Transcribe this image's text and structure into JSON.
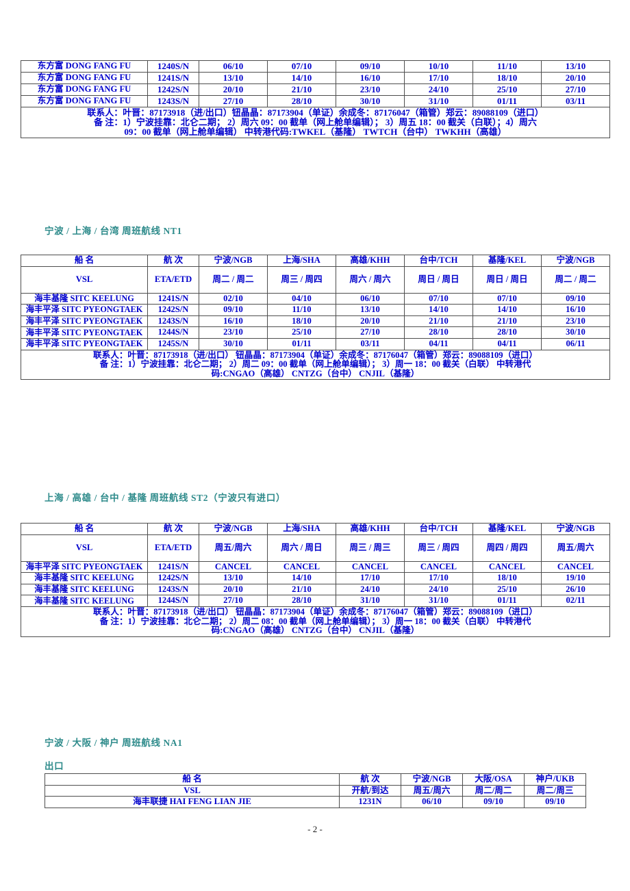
{
  "page": {
    "footer": "- 2 -"
  },
  "tables": {
    "dongfang": {
      "rows": [
        {
          "name": "东方富  DONG FANG FU",
          "voyage": "1240S/N",
          "dates": [
            "06/10",
            "07/10",
            "09/10",
            "10/10",
            "11/10",
            "13/10"
          ]
        },
        {
          "name": "东方富  DONG FANG FU",
          "voyage": "1241S/N",
          "dates": [
            "13/10",
            "14/10",
            "16/10",
            "17/10",
            "18/10",
            "20/10"
          ]
        },
        {
          "name": "东方富  DONG FANG FU",
          "voyage": "1242S/N",
          "dates": [
            "20/10",
            "21/10",
            "23/10",
            "24/10",
            "25/10",
            "27/10"
          ]
        },
        {
          "name": "东方富  DONG FANG FU",
          "voyage": "1243S/N",
          "dates": [
            "27/10",
            "28/10",
            "30/10",
            "31/10",
            "01/11",
            "03/11"
          ]
        }
      ],
      "notes": [
        "联系人：叶晋：87173918（进/出口）钮晶晶：87173904（单证）余成冬：87176047（箱管）郑云：89088109（进口）",
        "备  注：1）宁波挂靠：北仑二期；  2）周六 09：00 截单（网上舱单编辑）； 3）周五 18：00 截关（白联）；4）周六",
        "09：00 截单（网上舱单编辑）  中转港代码:TWKEL（基隆）  TWTCH（台中）  TWKHH（高雄）"
      ]
    },
    "nt1": {
      "caption": "宁波 / 上海 / 台湾 周班航线   NT1",
      "header1": [
        "船  名",
        "航  次",
        "宁波/NGB",
        "上海/SHA",
        "高雄/KHH",
        "台中/TCH",
        "基隆/KEL",
        "宁波/NGB"
      ],
      "header2": [
        "VSL",
        "ETA/ETD",
        "周二 / 周二",
        "周三 / 周四",
        "周六 / 周六",
        "周日 / 周日",
        "周日 / 周日",
        "周二 / 周二"
      ],
      "rows": [
        {
          "name": "海丰基隆 SITC KEELUNG",
          "voyage": "1241S/N",
          "dates": [
            "02/10",
            "04/10",
            "06/10",
            "07/10",
            "07/10",
            "09/10"
          ]
        },
        {
          "name": "海丰平泽 SITC PYEONGTAEK",
          "voyage": "1242S/N",
          "dates": [
            "09/10",
            "11/10",
            "13/10",
            "14/10",
            "14/10",
            "16/10"
          ]
        },
        {
          "name": "海丰平泽 SITC PYEONGTAEK",
          "voyage": "1243S/N",
          "dates": [
            "16/10",
            "18/10",
            "20/10",
            "21/10",
            "21/10",
            "23/10"
          ]
        },
        {
          "name": "海丰平泽 SITC PYEONGTAEK",
          "voyage": "1244S/N",
          "dates": [
            "23/10",
            "25/10",
            "27/10",
            "28/10",
            "28/10",
            "30/10"
          ]
        },
        {
          "name": "海丰平泽 SITC PYEONGTAEK",
          "voyage": "1245S/N",
          "dates": [
            "30/10",
            "01/11",
            "03/11",
            "04/11",
            "04/11",
            "06/11"
          ]
        }
      ],
      "notes": [
        "联系人：叶晋：87173918（进/出口） 钮晶晶：87173904（单证）余成冬：87176047（箱管）郑云：89088109（进口）",
        "备  注：1）宁波挂靠：北仑二期；  2）周二 09：00 截单（网上舱单编辑）； 3）周一 18：00 截关（白联）   中转港代",
        "码:CNGAO（高雄）  CNTZG（台中）  CNJIL（基隆）"
      ]
    },
    "st2": {
      "caption": "上海 / 高雄 / 台中 / 基隆 周班航线 ST2（宁波只有进口）",
      "header1": [
        "船  名",
        "航  次",
        "宁波/NGB",
        "上海/SHA",
        "高雄/KHH",
        "台中/TCH",
        "基隆/KEL",
        "宁波/NGB"
      ],
      "header2": [
        "VSL",
        "ETA/ETD",
        "周五/周六",
        "周六 / 周日",
        "周三 / 周三",
        "周三 / 周四",
        "周四 / 周四",
        "周五/周六"
      ],
      "rows": [
        {
          "name": "海丰平泽 SITC PYEONGTAEK",
          "voyage": "1241S/N",
          "dates": [
            "CANCEL",
            "CANCEL",
            "CANCEL",
            "CANCEL",
            "CANCEL",
            "CANCEL"
          ]
        },
        {
          "name": "海丰基隆 SITC KEELUNG",
          "voyage": "1242S/N",
          "dates": [
            "13/10",
            "14/10",
            "17/10",
            "17/10",
            "18/10",
            "19/10"
          ]
        },
        {
          "name": "海丰基隆 SITC KEELUNG",
          "voyage": "1243S/N",
          "dates": [
            "20/10",
            "21/10",
            "24/10",
            "24/10",
            "25/10",
            "26/10"
          ]
        },
        {
          "name": "海丰基隆 SITC KEELUNG",
          "voyage": "1244S/N",
          "dates": [
            "27/10",
            "28/10",
            "31/10",
            "31/10",
            "01/11",
            "02/11"
          ]
        }
      ],
      "notes": [
        "联系人：叶晋：87173918（进/出口）  钮晶晶：87173904（单证）余成冬：87176047（箱管）郑云：89088109（进口）",
        "备  注：1）宁波挂靠：北仑二期；  2）周二 08：00 截单（网上舱单编辑）； 3）周一 18：00 截关（白联）   中转港代",
        "码:CNGAO（高雄）  CNTZG（台中）  CNJIL（基隆）"
      ]
    },
    "na1": {
      "caption": "宁波 / 大阪 / 神户 周班航线   NA1",
      "subcaption": "出口",
      "header1": [
        "船    名",
        "航  次",
        "宁波/NGB",
        "大阪/OSA",
        "神户/UKB"
      ],
      "header2": [
        "VSL",
        "开航/到达",
        "周五/周六",
        "周二/周二",
        "周二/周三"
      ],
      "rows": [
        {
          "name": "海丰联捷 HAI FENG LIAN JIE",
          "voyage": "1231N",
          "dates": [
            "06/10",
            "09/10",
            "09/10"
          ]
        }
      ]
    }
  }
}
